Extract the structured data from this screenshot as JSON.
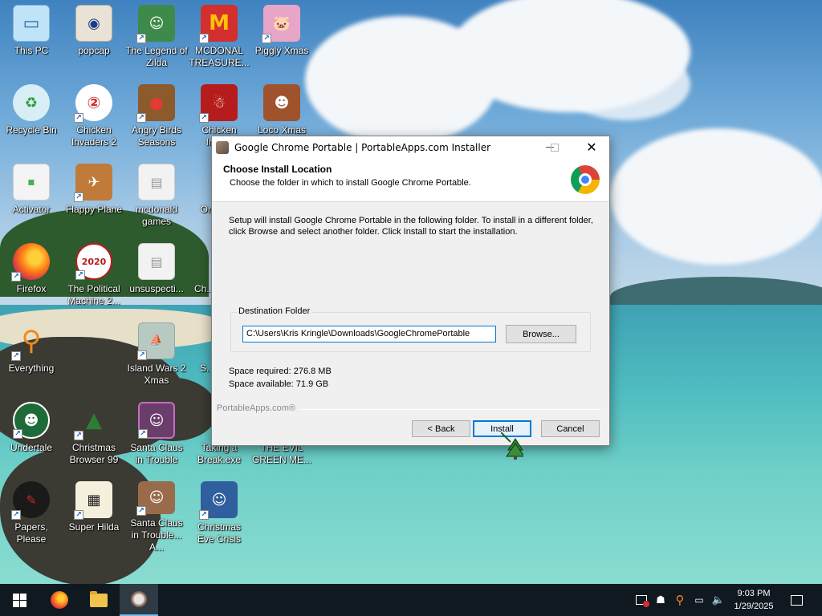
{
  "desktop": {
    "icons": [
      {
        "label": "This PC",
        "icon": "this-pc-icon"
      },
      {
        "label": "popcap",
        "icon": "popcap-folder-icon"
      },
      {
        "label": "The Legend of Zilda",
        "icon": "legend-of-zilda-icon"
      },
      {
        "label": "MCDONAL TREASURE...",
        "icon": "mcdonalds-treasure-icon"
      },
      {
        "label": "Piggly Xmas",
        "icon": "piggly-xmas-icon"
      },
      {
        "label": "Recycle Bin",
        "icon": "recycle-bin-icon"
      },
      {
        "label": "Chicken Invaders 2",
        "icon": "chicken-invaders-2-icon"
      },
      {
        "label": "Angry Birds Seasons",
        "icon": "angry-birds-seasons-icon"
      },
      {
        "label": "Chicken Inva...",
        "icon": "chicken-invaders-xmas-icon"
      },
      {
        "label": "Loco Xmas",
        "icon": "loco-xmas-icon"
      },
      {
        "label": "Activator",
        "icon": "activator-icon"
      },
      {
        "label": "Flappy Plane",
        "icon": "flappy-plane-icon"
      },
      {
        "label": "mcdonald games",
        "icon": "mcdonald-games-folder-icon"
      },
      {
        "label": "Ornam...",
        "icon": "ornaments-icon"
      },
      {
        "label": "Firefox",
        "icon": "firefox-icon"
      },
      {
        "label": "The Political Machine 2...",
        "icon": "political-machine-icon"
      },
      {
        "label": "unsuspecti...",
        "icon": "unsuspecting-folder-icon"
      },
      {
        "label": "Ch... Swe...",
        "icon": "christmas-sweeper-icon"
      },
      {
        "label": "Everything",
        "icon": "everything-search-icon"
      },
      {
        "label": "Island Wars 2 Xmas",
        "icon": "island-wars-2-xmas-icon"
      },
      {
        "label": "S... Ani...",
        "icon": "santa-animation-icon"
      },
      {
        "label": "Undertale",
        "icon": "undertale-icon"
      },
      {
        "label": "Christmas Browser 99",
        "icon": "christmas-browser-99-icon"
      },
      {
        "label": "Santa Claus in Trouble",
        "icon": "santa-claus-trouble-icon"
      },
      {
        "label": "Taking a Break.exe",
        "icon": "taking-a-break-icon"
      },
      {
        "label": "THE EVIL GREEN ME...",
        "icon": "evil-green-icon"
      },
      {
        "label": "Papers, Please",
        "icon": "papers-please-icon"
      },
      {
        "label": "Super Hilda",
        "icon": "super-hilda-icon"
      },
      {
        "label": "Santa Claus in Trouble... A...",
        "icon": "santa-claus-trouble-again-icon"
      },
      {
        "label": "Christmas Eve Crisis",
        "icon": "christmas-eve-crisis-icon"
      }
    ]
  },
  "installer": {
    "title": "Google Chrome Portable | PortableApps.com Installer",
    "header_title": "Choose Install Location",
    "header_subtitle": "Choose the folder in which to install Google Chrome Portable.",
    "body_text": "Setup will install Google Chrome Portable in the following folder. To install in a different folder, click Browse and select another folder. Click Install to start the installation.",
    "destination_legend": "Destination Folder",
    "destination_value": "C:\\Users\\Kris Kringle\\Downloads\\GoogleChromePortable",
    "browse_label": "Browse...",
    "space_required": "Space required: 276.8 MB",
    "space_available": "Space available: 71.9 GB",
    "branding": "PortableApps.com®",
    "back_label": "< Back",
    "install_label": "Install",
    "cancel_label": "Cancel",
    "close_glyph": "✕"
  },
  "taskbar": {
    "time": "9:03 PM",
    "date": "1/29/2025",
    "pinned": [
      "start-icon",
      "firefox-icon",
      "file-explorer-icon",
      "installer-icon"
    ],
    "tray": [
      "security-icon",
      "network-user-icon",
      "everything-tray-icon",
      "network-icon",
      "volume-icon",
      "notifications-icon"
    ]
  },
  "colors": {
    "accent": "#0078d7",
    "taskbar": "#101820",
    "dialog_bg": "#f0f0f0"
  }
}
